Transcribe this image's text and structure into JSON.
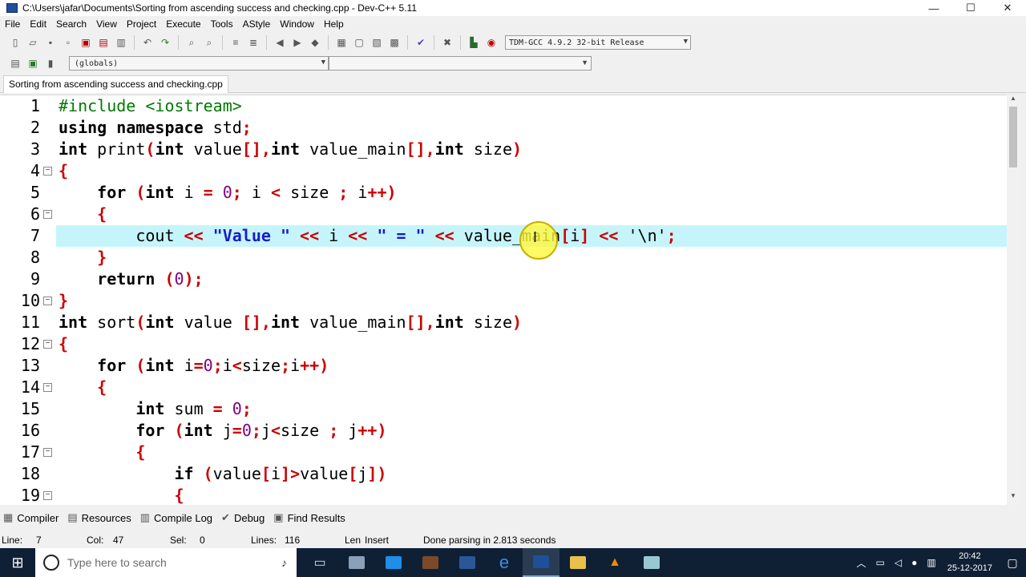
{
  "window": {
    "title": "C:\\Users\\jafar\\Documents\\Sorting from ascending success and checking.cpp - Dev-C++ 5.11",
    "minimize_glyph": "—",
    "maximize_glyph": "☐",
    "close_glyph": "✕"
  },
  "menu": [
    "File",
    "Edit",
    "Search",
    "View",
    "Project",
    "Execute",
    "Tools",
    "AStyle",
    "Window",
    "Help"
  ],
  "toolbar": {
    "compiler": "TDM-GCC 4.9.2 32-bit Release",
    "scope": "(globals)"
  },
  "tab": {
    "label": "Sorting from ascending success and checking.cpp"
  },
  "editor": {
    "current_line": 7,
    "line_numbers": [
      "1",
      "2",
      "3",
      "4",
      "5",
      "6",
      "7",
      "8",
      "9",
      "10",
      "11",
      "12",
      "13",
      "14",
      "15",
      "16",
      "17",
      "18",
      "19"
    ],
    "fold_lines": [
      4,
      6,
      10,
      12,
      14,
      17,
      19
    ]
  },
  "code": [
    [
      {
        "t": "#include <iostream>",
        "c": "pre"
      }
    ],
    [
      {
        "t": "using namespace ",
        "c": "kw"
      },
      {
        "t": "std",
        "c": ""
      },
      {
        "t": ";",
        "c": "sym"
      }
    ],
    [
      {
        "t": "int ",
        "c": "kw"
      },
      {
        "t": "print",
        "c": ""
      },
      {
        "t": "(",
        "c": "sym"
      },
      {
        "t": "int ",
        "c": "kw"
      },
      {
        "t": "value",
        "c": ""
      },
      {
        "t": "[],",
        "c": "sym"
      },
      {
        "t": "int ",
        "c": "kw"
      },
      {
        "t": "value_main",
        "c": ""
      },
      {
        "t": "[],",
        "c": "sym"
      },
      {
        "t": "int ",
        "c": "kw"
      },
      {
        "t": "size",
        "c": ""
      },
      {
        "t": ")",
        "c": "sym"
      }
    ],
    [
      {
        "t": "{",
        "c": "sym"
      }
    ],
    [
      {
        "t": "    ",
        "c": ""
      },
      {
        "t": "for ",
        "c": "kw"
      },
      {
        "t": "(",
        "c": "sym"
      },
      {
        "t": "int ",
        "c": "kw"
      },
      {
        "t": "i ",
        "c": ""
      },
      {
        "t": "= ",
        "c": "sym"
      },
      {
        "t": "0",
        "c": "num"
      },
      {
        "t": "; ",
        "c": "sym"
      },
      {
        "t": "i ",
        "c": ""
      },
      {
        "t": "< ",
        "c": "sym"
      },
      {
        "t": "size ",
        "c": ""
      },
      {
        "t": "; ",
        "c": "sym"
      },
      {
        "t": "i",
        "c": ""
      },
      {
        "t": "++)",
        "c": "sym"
      }
    ],
    [
      {
        "t": "    ",
        "c": ""
      },
      {
        "t": "{",
        "c": "sym"
      }
    ],
    [
      {
        "t": "        ",
        "c": ""
      },
      {
        "t": "cout ",
        "c": ""
      },
      {
        "t": "<< ",
        "c": "sym"
      },
      {
        "t": "\"Value \" ",
        "c": "str"
      },
      {
        "t": "<< ",
        "c": "sym"
      },
      {
        "t": "i ",
        "c": ""
      },
      {
        "t": "<< ",
        "c": "sym"
      },
      {
        "t": "\" = \" ",
        "c": "str"
      },
      {
        "t": "<< ",
        "c": "sym"
      },
      {
        "t": "value_main",
        "c": ""
      },
      {
        "t": "[",
        "c": "sym"
      },
      {
        "t": "i",
        "c": ""
      },
      {
        "t": "] << ",
        "c": "sym"
      },
      {
        "t": "'\\n'",
        "c": ""
      },
      {
        "t": ";",
        "c": "sym"
      }
    ],
    [
      {
        "t": "    ",
        "c": ""
      },
      {
        "t": "}",
        "c": "sym"
      }
    ],
    [
      {
        "t": "    ",
        "c": ""
      },
      {
        "t": "return ",
        "c": "kw"
      },
      {
        "t": "(",
        "c": "sym"
      },
      {
        "t": "0",
        "c": "num"
      },
      {
        "t": ");",
        "c": "sym"
      }
    ],
    [
      {
        "t": "}",
        "c": "sym"
      }
    ],
    [
      {
        "t": "int ",
        "c": "kw"
      },
      {
        "t": "sort",
        "c": ""
      },
      {
        "t": "(",
        "c": "sym"
      },
      {
        "t": "int ",
        "c": "kw"
      },
      {
        "t": "value ",
        "c": ""
      },
      {
        "t": "[],",
        "c": "sym"
      },
      {
        "t": "int ",
        "c": "kw"
      },
      {
        "t": "value_main",
        "c": ""
      },
      {
        "t": "[],",
        "c": "sym"
      },
      {
        "t": "int ",
        "c": "kw"
      },
      {
        "t": "size",
        "c": ""
      },
      {
        "t": ")",
        "c": "sym"
      }
    ],
    [
      {
        "t": "{",
        "c": "sym"
      }
    ],
    [
      {
        "t": "    ",
        "c": ""
      },
      {
        "t": "for ",
        "c": "kw"
      },
      {
        "t": "(",
        "c": "sym"
      },
      {
        "t": "int ",
        "c": "kw"
      },
      {
        "t": "i",
        "c": ""
      },
      {
        "t": "=",
        "c": "sym"
      },
      {
        "t": "0",
        "c": "num"
      },
      {
        "t": ";",
        "c": "sym"
      },
      {
        "t": "i",
        "c": ""
      },
      {
        "t": "<",
        "c": "sym"
      },
      {
        "t": "size",
        "c": ""
      },
      {
        "t": ";",
        "c": "sym"
      },
      {
        "t": "i",
        "c": ""
      },
      {
        "t": "++)",
        "c": "sym"
      }
    ],
    [
      {
        "t": "    ",
        "c": ""
      },
      {
        "t": "{",
        "c": "sym"
      }
    ],
    [
      {
        "t": "        ",
        "c": ""
      },
      {
        "t": "int ",
        "c": "kw"
      },
      {
        "t": "sum ",
        "c": ""
      },
      {
        "t": "= ",
        "c": "sym"
      },
      {
        "t": "0",
        "c": "num"
      },
      {
        "t": ";",
        "c": "sym"
      }
    ],
    [
      {
        "t": "        ",
        "c": ""
      },
      {
        "t": "for ",
        "c": "kw"
      },
      {
        "t": "(",
        "c": "sym"
      },
      {
        "t": "int ",
        "c": "kw"
      },
      {
        "t": "j",
        "c": ""
      },
      {
        "t": "=",
        "c": "sym"
      },
      {
        "t": "0",
        "c": "num"
      },
      {
        "t": ";",
        "c": "sym"
      },
      {
        "t": "j",
        "c": ""
      },
      {
        "t": "<",
        "c": "sym"
      },
      {
        "t": "size ",
        "c": ""
      },
      {
        "t": "; ",
        "c": "sym"
      },
      {
        "t": "j",
        "c": ""
      },
      {
        "t": "++)",
        "c": "sym"
      }
    ],
    [
      {
        "t": "        ",
        "c": ""
      },
      {
        "t": "{",
        "c": "sym"
      }
    ],
    [
      {
        "t": "            ",
        "c": ""
      },
      {
        "t": "if ",
        "c": "kw"
      },
      {
        "t": "(",
        "c": "sym"
      },
      {
        "t": "value",
        "c": ""
      },
      {
        "t": "[",
        "c": "sym"
      },
      {
        "t": "i",
        "c": ""
      },
      {
        "t": "]>",
        "c": "sym"
      },
      {
        "t": "value",
        "c": ""
      },
      {
        "t": "[",
        "c": "sym"
      },
      {
        "t": "j",
        "c": ""
      },
      {
        "t": "])",
        "c": "sym"
      }
    ],
    [
      {
        "t": "            ",
        "c": ""
      },
      {
        "t": "{",
        "c": "sym"
      }
    ]
  ],
  "bottom_tabs": [
    {
      "icon": "compiler-icon",
      "glyph": "▦",
      "label": "Compiler"
    },
    {
      "icon": "resources-icon",
      "glyph": "▤",
      "label": "Resources"
    },
    {
      "icon": "compile-log-icon",
      "glyph": "▥",
      "label": "Compile Log"
    },
    {
      "icon": "debug-icon",
      "glyph": "✔",
      "label": "Debug"
    },
    {
      "icon": "find-results-icon",
      "glyph": "▣",
      "label": "Find Results"
    }
  ],
  "status": {
    "line_label": "Line:",
    "line_value": "7",
    "col_label": "Col:",
    "col_value": "47",
    "sel_label": "Sel:",
    "sel_value": "0",
    "lines_label": "Lines:",
    "lines_value": "116",
    "len_label": "Len",
    "mode": "Insert",
    "message": "Done parsing in 2.813 seconds"
  },
  "taskbar": {
    "search_placeholder": "Type here to search",
    "time": "20:42",
    "date": "25-12-2017"
  },
  "colors": {
    "keyword": "#000000",
    "symbol": "#cc0000",
    "string": "#1a1acc",
    "number": "#800080",
    "preprocessor": "#007a00",
    "current_line": "#c5f5fb"
  }
}
